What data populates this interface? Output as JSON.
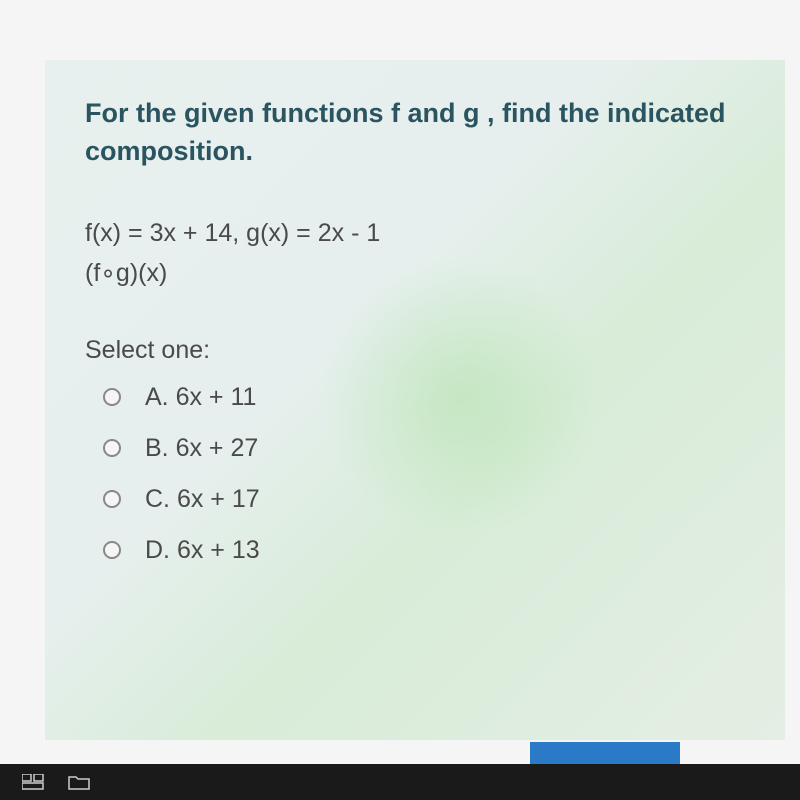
{
  "question": {
    "title": "For the given functions f and g , find the indicated composition.",
    "given": "f(x) = 3x + 14, g(x) = 2x - 1",
    "composition": "(f∘g)(x)",
    "select_label": "Select one:",
    "options": [
      {
        "label": "A. 6x + 11"
      },
      {
        "label": "B. 6x + 27"
      },
      {
        "label": "C. 6x + 17"
      },
      {
        "label": "D. 6x + 13"
      }
    ]
  }
}
